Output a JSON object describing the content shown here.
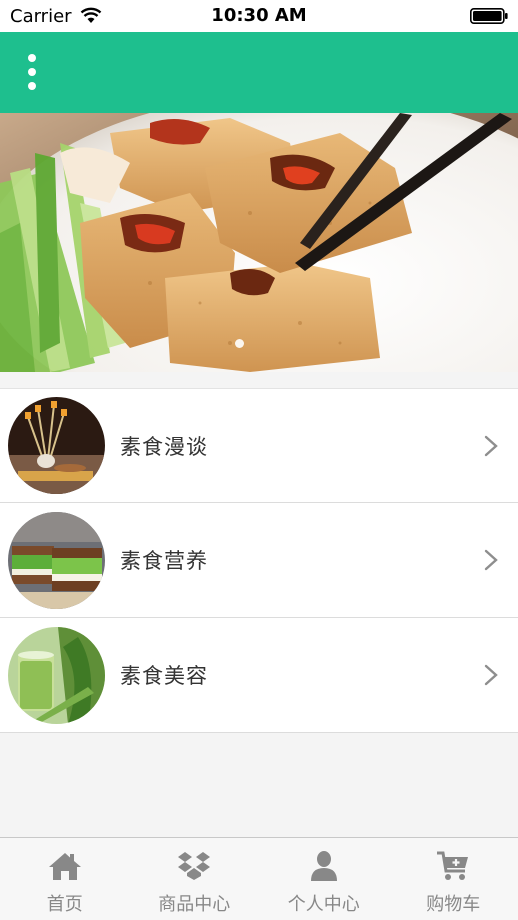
{
  "status_bar": {
    "carrier": "Carrier",
    "time": "10:30 AM"
  },
  "colors": {
    "header": "#1ebf8e",
    "tab_inactive": "#888888"
  },
  "banner": {
    "image": "stuffed fried tofu with chopsticks and cucumber",
    "page_indicator": {
      "count": 1,
      "active": 1
    }
  },
  "categories": [
    {
      "label": "素食漫谈",
      "thumbnail": "dessert-platter"
    },
    {
      "label": "素食营养",
      "thumbnail": "vegetable-sandwich"
    },
    {
      "label": "素食美容",
      "thumbnail": "green-juice"
    }
  ],
  "tabs": [
    {
      "label": "首页",
      "icon": "home-icon"
    },
    {
      "label": "商品中心",
      "icon": "dropbox-icon"
    },
    {
      "label": "个人中心",
      "icon": "person-icon"
    },
    {
      "label": "购物车",
      "icon": "cart-icon"
    }
  ]
}
